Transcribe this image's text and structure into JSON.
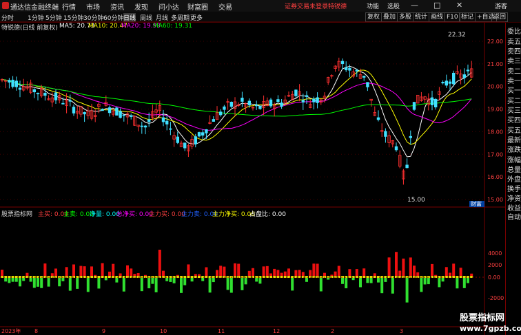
{
  "titlebar": {
    "app_title": "通达信金融终端",
    "menus": [
      "行情",
      "市场",
      "资讯",
      "发现",
      "问小达",
      "财富圈",
      "交易"
    ],
    "notice": "证券交易未登录",
    "stock": "特锐德",
    "right_menus": [
      "功能",
      "选股",
      "游客"
    ],
    "window_btns": [
      "—",
      "□",
      "✕"
    ]
  },
  "toolbar": {
    "periods": [
      "分时",
      "1分钟",
      "5分钟",
      "15分钟",
      "30分钟",
      "60分钟",
      "日线",
      "周线",
      "月线",
      "多周期",
      "更多"
    ],
    "active": "日线",
    "right_buttons": [
      "复权",
      "叠加",
      "多股",
      "统计",
      "画线",
      "F10",
      "标记",
      "+自选",
      "返回"
    ]
  },
  "infobar": {
    "stock_label": "特锐德(日线 前复权)",
    "ma": [
      {
        "label": "MA5: 20.73",
        "color": "#ffffff"
      },
      {
        "label": "MA10: 20.47",
        "color": "#ffff00"
      },
      {
        "label": "MA20: 19.93",
        "color": "#ff00ff"
      },
      {
        "label": "MA60: 19.31",
        "color": "#00ff00"
      }
    ]
  },
  "price_axis": {
    "labels": [
      "22.00",
      "21.00",
      "20.00",
      "19.00",
      "18.00",
      "17.00",
      "16.00",
      "15.00"
    ],
    "max_label": "22.32",
    "min_label": "15.00",
    "tag": "财富"
  },
  "sidebar": {
    "items": [
      "委比",
      "卖五",
      "卖四",
      "卖三",
      "卖二",
      "卖一",
      "买一",
      "买二",
      "买三",
      "买四",
      "买五",
      "最新",
      "涨跌",
      "涨幅",
      "总量",
      "外盘",
      "换手",
      "净资",
      "收益"
    ],
    "bottom": "自动"
  },
  "indicator": {
    "name": "股票指标网",
    "fields": [
      {
        "label": "主买: 0.00",
        "color": "#ff4040"
      },
      {
        "label": "主卖: 0.00",
        "color": "#00ff00"
      },
      {
        "label": "净量: 0.00",
        "color": "#00ffff"
      },
      {
        "label": "总净买: 0.00",
        "color": "#ff00ff"
      },
      {
        "label": "主力买: 0.00",
        "color": "#ff4040"
      },
      {
        "label": "主力卖: 0.00",
        "color": "#2060ff"
      },
      {
        "label": "主力净买: 0.00",
        "color": "#ffff00"
      },
      {
        "label": "占盘比: 0.00",
        "color": "#ffffff"
      }
    ],
    "axis_labels": [
      "4000",
      "2000",
      "0.00",
      "-2000"
    ]
  },
  "date_axis": {
    "labels": [
      "2023年",
      "8",
      "9",
      "10",
      "11",
      "12",
      "2",
      "3"
    ]
  },
  "watermark": {
    "line1": "股票指标网",
    "line2": "www.7gpzb.com"
  }
}
